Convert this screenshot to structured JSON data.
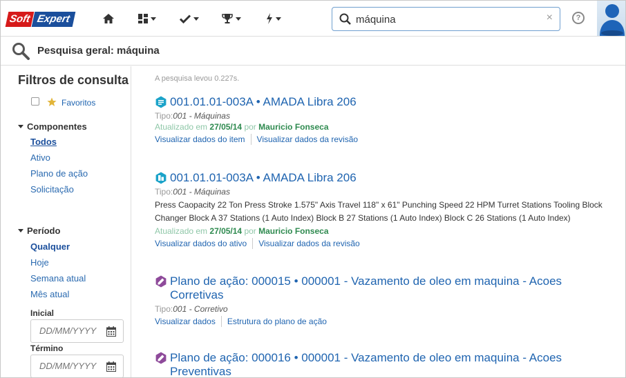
{
  "app": {
    "logo_part1": "Soft",
    "logo_part2": "Expert"
  },
  "search": {
    "value": "máquina",
    "clear": "×"
  },
  "help": "?",
  "page_title": "Pesquisa geral: máquina",
  "sidebar": {
    "heading": "Filtros de consulta",
    "favorites_label": "Favoritos",
    "components": {
      "label": "Componentes",
      "items": [
        "Todos",
        "Ativo",
        "Plano de ação",
        "Solicitação"
      ]
    },
    "period": {
      "label": "Período",
      "items": [
        "Qualquer",
        "Hoje",
        "Semana atual",
        "Mês atual"
      ],
      "start_label": "Inicial",
      "end_label": "Término",
      "date_placeholder": "DD/MM/YYYY"
    }
  },
  "results": {
    "timing": "A pesquisa levou 0.227s.",
    "items": [
      {
        "title": "001.01.01-003A • AMADA Libra 206",
        "type_label": "Tipo:",
        "type_value": "001 - Máquinas",
        "updated_prefix": "Atualizado em",
        "updated_date": "27/05/14",
        "updated_by": "por",
        "updated_user": "Mauricio Fonseca",
        "actions": [
          "Visualizar dados do item",
          "Visualizar dados da revisão"
        ]
      },
      {
        "title": "001.01.01-003A • AMADA Libra 206",
        "type_label": "Tipo:",
        "type_value": "001 - Máquinas",
        "description": "Press Caopacity 22 Ton Press Stroke 1.575\" Axis Travel 118\" x 61\" Punching Speed 22 HPM Turret Stations Tooling Block Changer Block A 37 Stations (1 Auto Index) Block B 27 Stations (1 Auto Index) Block C 26 Stations (1 Auto Index)",
        "updated_prefix": "Atualizado em",
        "updated_date": "27/05/14",
        "updated_by": "por",
        "updated_user": "Mauricio Fonseca",
        "actions": [
          "Visualizar dados do ativo",
          "Visualizar dados da revisão"
        ]
      },
      {
        "title": "Plano de ação: 000015 • 000001 - Vazamento de oleo em maquina - Acoes Corretivas",
        "type_label": "Tipo:",
        "type_value": "001 - Corretivo",
        "actions": [
          "Visualizar dados",
          "Estrutura do plano de ação"
        ]
      },
      {
        "title": "Plano de ação: 000016 • 000001 - Vazamento de oleo em maquina - Acoes Preventivas"
      }
    ]
  },
  "colors": {
    "link": "#1f64b0",
    "item_icon": "#1ba3c9",
    "plan_icon": "#8e4a9a",
    "updated_green": "#2e8a4f"
  },
  "icons": [
    "home-icon",
    "dashboard-icon",
    "checkmark-icon",
    "trophy-icon",
    "lightning-icon",
    "search-icon",
    "help-icon",
    "star-icon",
    "calendar-icon"
  ]
}
